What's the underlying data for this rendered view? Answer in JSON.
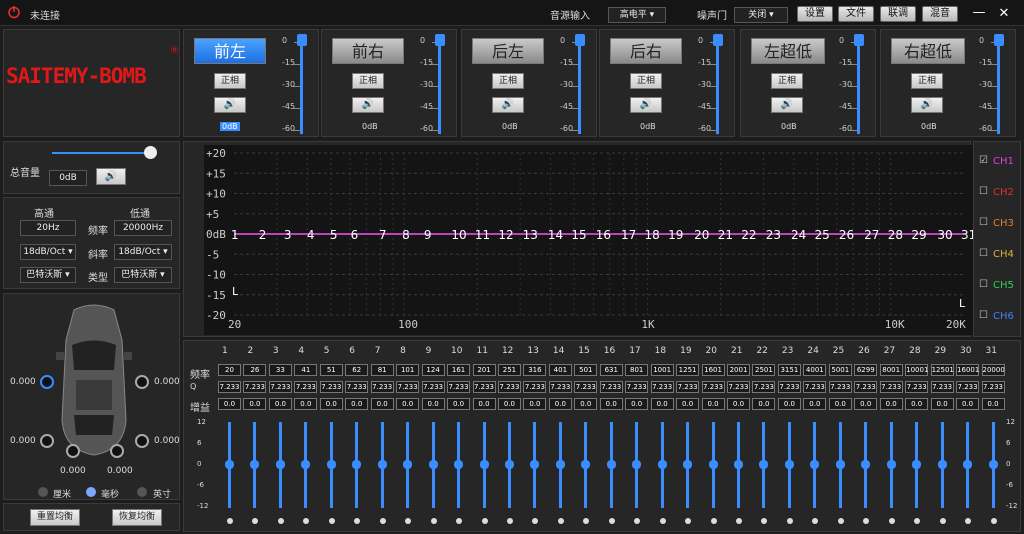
{
  "title": {
    "status": "未连接",
    "source_label": "音源输入",
    "source_value": "高电平",
    "gate_label": "噪声门",
    "gate_value": "关闭",
    "btns": [
      "设置",
      "文件",
      "联调",
      "混音"
    ]
  },
  "logo": "SAITEMY-BOMB",
  "channels": [
    {
      "name": "前左",
      "phase": "正相",
      "db": "0dB"
    },
    {
      "name": "前右",
      "phase": "正相",
      "db": "0dB"
    },
    {
      "name": "后左",
      "phase": "正相",
      "db": "0dB"
    },
    {
      "name": "后右",
      "phase": "正相",
      "db": "0dB"
    },
    {
      "name": "左超低",
      "phase": "正相",
      "db": "0dB"
    },
    {
      "name": "右超低",
      "phase": "正相",
      "db": "0dB"
    }
  ],
  "ch_scale": [
    "0",
    "-15",
    "-30",
    "-45",
    "-60"
  ],
  "master": {
    "label": "总音量",
    "value": "0dB",
    "level": 0.93
  },
  "crossover": {
    "hp": "高通",
    "lp": "低通",
    "freq_label": "频率",
    "slope_label": "斜率",
    "type_label": "类型",
    "hp_freq": "20Hz",
    "lp_freq": "20000Hz",
    "hp_slope": "18dB/Oct",
    "lp_slope": "18dB/Oct",
    "hp_type": "巴特沃斯",
    "lp_type": "巴特沃斯"
  },
  "delay": {
    "values": [
      "0.000",
      "0.000",
      "0.000",
      "0.000",
      "0.000",
      "0.000"
    ],
    "units": [
      "厘米",
      "毫秒",
      "英寸"
    ]
  },
  "bottom_btns": [
    "重置均衡",
    "恢复均衡"
  ],
  "graph": {
    "y_labels": [
      "+20",
      "+15",
      "+10",
      "+5",
      "0dB",
      "-5",
      "-10",
      "-15",
      "-20"
    ],
    "x_labels": [
      "20",
      "100",
      "1K",
      "10K",
      "20K"
    ],
    "left_marker": "L",
    "right_marker": "L"
  },
  "graph_points": [
    "1",
    "2",
    "3",
    "4",
    "5",
    "6",
    "7",
    "8",
    "9",
    "10",
    "11",
    "12",
    "13",
    "14",
    "15",
    "16",
    "17",
    "18",
    "19",
    "20",
    "21",
    "22",
    "23",
    "24",
    "25",
    "26",
    "27",
    "28",
    "29",
    "30",
    "31"
  ],
  "ch_select": [
    {
      "name": "CH1",
      "color": "#e040e0",
      "checked": "☑"
    },
    {
      "name": "CH2",
      "color": "#e03030",
      "checked": "☐"
    },
    {
      "name": "CH3",
      "color": "#e08030",
      "checked": "☐"
    },
    {
      "name": "CH4",
      "color": "#e0b030",
      "checked": "☐"
    },
    {
      "name": "CH5",
      "color": "#30d050",
      "checked": "☐"
    },
    {
      "name": "CH6",
      "color": "#4080ff",
      "checked": "☐"
    }
  ],
  "eq": {
    "row_labels": [
      "频率",
      "Q",
      "增益"
    ],
    "bands": [
      "1",
      "2",
      "3",
      "4",
      "5",
      "6",
      "7",
      "8",
      "9",
      "10",
      "11",
      "12",
      "13",
      "14",
      "15",
      "16",
      "17",
      "18",
      "19",
      "20",
      "21",
      "22",
      "23",
      "24",
      "25",
      "26",
      "27",
      "28",
      "29",
      "30",
      "31"
    ],
    "freqs": [
      "20",
      "26",
      "33",
      "41",
      "51",
      "62",
      "81",
      "101",
      "124",
      "161",
      "201",
      "251",
      "316",
      "401",
      "501",
      "631",
      "801",
      "1001",
      "1251",
      "1601",
      "2001",
      "2501",
      "3151",
      "4001",
      "5001",
      "6299",
      "8001",
      "10001",
      "12501",
      "16001",
      "20000"
    ],
    "q": "7.233",
    "gain": "0.0",
    "scale": [
      "12",
      "6",
      "0",
      "-6",
      "-12"
    ]
  }
}
